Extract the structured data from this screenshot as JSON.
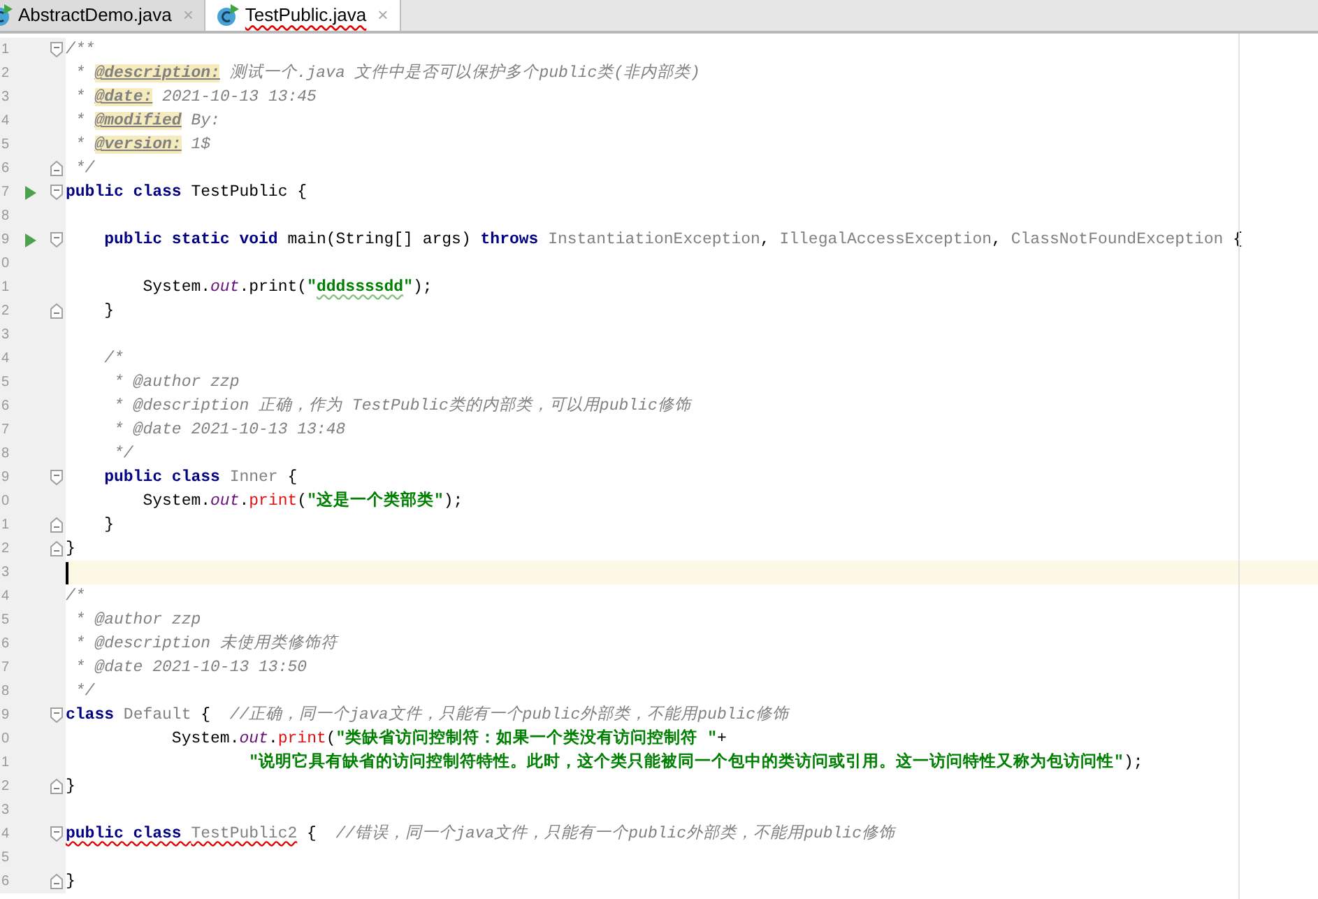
{
  "tabs": [
    {
      "label": "AbstractDemo.java",
      "selected": false,
      "error": false,
      "close": "×"
    },
    {
      "label": "TestPublic.java",
      "selected": true,
      "error": true,
      "close": "×"
    }
  ],
  "lines": [
    {
      "number": "1",
      "fold_open": true,
      "tokens": [
        {
          "kind": "doc",
          "text": "/**"
        }
      ]
    },
    {
      "number": "2",
      "tokens": [
        {
          "kind": "doc",
          "text": " * "
        },
        {
          "kind": "doctag",
          "text": "@description:"
        },
        {
          "kind": "doc",
          "text": " 测试一个.java 文件中是否可以保护多个public类(非内部类)"
        }
      ]
    },
    {
      "number": "3",
      "tokens": [
        {
          "kind": "doc",
          "text": " * "
        },
        {
          "kind": "doctag",
          "text": "@date:"
        },
        {
          "kind": "doc",
          "text": " 2021-10-13 13:45"
        }
      ]
    },
    {
      "number": "4",
      "tokens": [
        {
          "kind": "doc",
          "text": " * "
        },
        {
          "kind": "doctag",
          "text": "@modified"
        },
        {
          "kind": "doc",
          "text": " By:"
        }
      ]
    },
    {
      "number": "5",
      "tokens": [
        {
          "kind": "doc",
          "text": " * "
        },
        {
          "kind": "doctag",
          "text": "@version:"
        },
        {
          "kind": "doc",
          "text": " 1$"
        }
      ]
    },
    {
      "number": "6",
      "fold_close": true,
      "tokens": [
        {
          "kind": "doc",
          "text": " */"
        }
      ]
    },
    {
      "number": "7",
      "run": true,
      "fold_open": true,
      "tokens": [
        {
          "kind": "keyword",
          "text": "public class "
        },
        {
          "kind": "plain",
          "text": "TestPublic {"
        }
      ]
    },
    {
      "number": "8"
    },
    {
      "number": "9",
      "run": true,
      "fold_open": true,
      "tokens": [
        {
          "kind": "keyword",
          "text": "    public static void "
        },
        {
          "kind": "plain",
          "text": "main(String[] args) "
        },
        {
          "kind": "keyword",
          "text": "throws "
        },
        {
          "kind": "unused",
          "text": "InstantiationException"
        },
        {
          "kind": "plain",
          "text": ", "
        },
        {
          "kind": "unused",
          "text": "IllegalAccessException"
        },
        {
          "kind": "plain",
          "text": ", "
        },
        {
          "kind": "unused",
          "text": "ClassNotFoundException"
        },
        {
          "kind": "plain",
          "text": " {"
        }
      ]
    },
    {
      "number": "0"
    },
    {
      "number": "1",
      "tokens": [
        {
          "kind": "plain",
          "text": "        System."
        },
        {
          "kind": "field",
          "text": "out"
        },
        {
          "kind": "plain",
          "text": ".print("
        },
        {
          "kind": "string",
          "text": "\""
        },
        {
          "kind": "string",
          "text": "dddssssdd",
          "misspelled": true
        },
        {
          "kind": "string",
          "text": "\""
        },
        {
          "kind": "plain",
          "text": ");"
        }
      ]
    },
    {
      "number": "2",
      "fold_close": true,
      "tokens": [
        {
          "kind": "plain",
          "text": "    }"
        }
      ]
    },
    {
      "number": "3"
    },
    {
      "number": "4",
      "tokens": [
        {
          "kind": "comment",
          "text": "    /*"
        }
      ]
    },
    {
      "number": "5",
      "tokens": [
        {
          "kind": "comment",
          "text": "     * @author zzp"
        }
      ]
    },
    {
      "number": "6",
      "tokens": [
        {
          "kind": "comment",
          "text": "     * @description 正确，作为 TestPublic类的内部类，可以用public修饰"
        }
      ]
    },
    {
      "number": "7",
      "tokens": [
        {
          "kind": "comment",
          "text": "     * @date 2021-10-13 13:48"
        }
      ]
    },
    {
      "number": "8",
      "tokens": [
        {
          "kind": "comment",
          "text": "     */"
        }
      ]
    },
    {
      "number": "9",
      "fold_open": true,
      "tokens": [
        {
          "kind": "keyword",
          "text": "    public class "
        },
        {
          "kind": "unused",
          "text": "Inner"
        },
        {
          "kind": "plain",
          "text": " {"
        }
      ]
    },
    {
      "number": "0",
      "tokens": [
        {
          "kind": "plain",
          "text": "        System."
        },
        {
          "kind": "field",
          "text": "out"
        },
        {
          "kind": "plain",
          "text": "."
        },
        {
          "kind": "call",
          "text": "print"
        },
        {
          "kind": "plain",
          "text": "("
        },
        {
          "kind": "string",
          "text": "\"这是一个类部类\""
        },
        {
          "kind": "plain",
          "text": ");"
        }
      ]
    },
    {
      "number": "1",
      "fold_close": true,
      "tokens": [
        {
          "kind": "plain",
          "text": "    }"
        }
      ]
    },
    {
      "number": "2",
      "fold_close": true,
      "tokens": [
        {
          "kind": "plain",
          "text": "}"
        }
      ]
    },
    {
      "number": "3",
      "current": true
    },
    {
      "number": "4",
      "tokens": [
        {
          "kind": "comment",
          "text": "/*"
        }
      ]
    },
    {
      "number": "5",
      "tokens": [
        {
          "kind": "comment",
          "text": " * @author zzp"
        }
      ]
    },
    {
      "number": "6",
      "tokens": [
        {
          "kind": "comment",
          "text": " * @description 未使用类修饰符"
        }
      ]
    },
    {
      "number": "7",
      "tokens": [
        {
          "kind": "comment",
          "text": " * @date 2021-10-13 13:50"
        }
      ]
    },
    {
      "number": "8",
      "tokens": [
        {
          "kind": "comment",
          "text": " */"
        }
      ]
    },
    {
      "number": "9",
      "fold_open": true,
      "tokens": [
        {
          "kind": "keyword",
          "text": "class "
        },
        {
          "kind": "unused",
          "text": "Default"
        },
        {
          "kind": "plain",
          "text": " {  "
        },
        {
          "kind": "comment",
          "text": "//正确，同一个java文件，只能有一个public外部类，不能用public修饰"
        }
      ]
    },
    {
      "number": "0",
      "tokens": [
        {
          "kind": "plain",
          "text": "           System."
        },
        {
          "kind": "field",
          "text": "out"
        },
        {
          "kind": "plain",
          "text": "."
        },
        {
          "kind": "call",
          "text": "print"
        },
        {
          "kind": "plain",
          "text": "("
        },
        {
          "kind": "string",
          "text": "\"类缺省访问控制符：如果一个类没有访问控制符 \""
        },
        {
          "kind": "plain",
          "text": "+"
        }
      ]
    },
    {
      "number": "1",
      "tokens": [
        {
          "kind": "string",
          "text": "                   \"说明它具有缺省的访问控制符特性。此时，这个类只能被同一个包中的类访问或引用。这一访问特性又称为包访问性\""
        },
        {
          "kind": "plain",
          "text": ");"
        }
      ]
    },
    {
      "number": "2",
      "fold_close": true,
      "tokens": [
        {
          "kind": "plain",
          "text": "}"
        }
      ]
    },
    {
      "number": "3"
    },
    {
      "number": "4",
      "fold_open": true,
      "tokens": [
        {
          "kind": "keyword",
          "text": "public class ",
          "error": true
        },
        {
          "kind": "unused",
          "text": "TestPublic2",
          "error": true
        },
        {
          "kind": "plain",
          "text": " {  "
        },
        {
          "kind": "comment",
          "text": "//错误，同一个java文件，只能有一个public外部类，不能用public修饰"
        }
      ]
    },
    {
      "number": "5"
    },
    {
      "number": "6",
      "fold_close": true,
      "tokens": [
        {
          "kind": "plain",
          "text": "}"
        }
      ]
    }
  ]
}
